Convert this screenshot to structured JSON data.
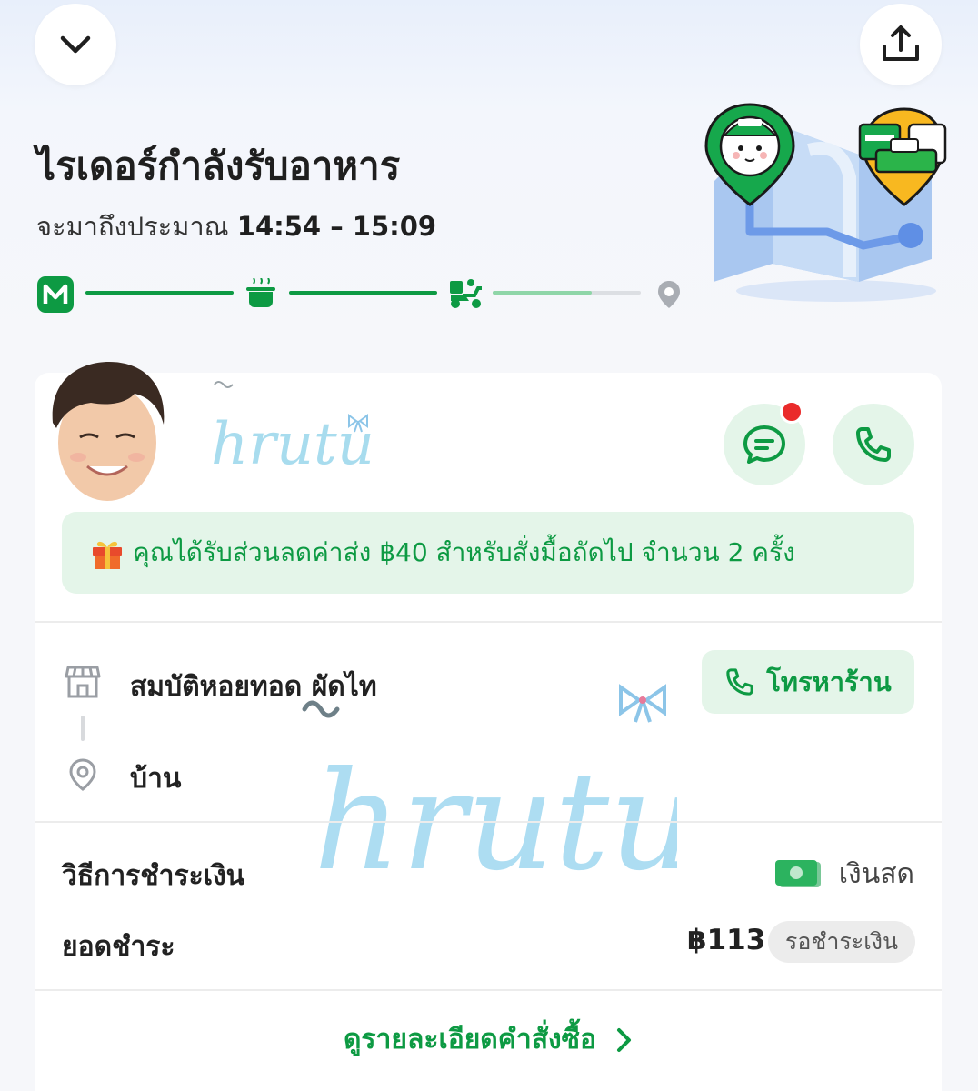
{
  "header": {
    "back_icon": "chevron-down-icon",
    "share_icon": "share-icon"
  },
  "status": {
    "title": "ไรเดอร์กำลังรับอาหาร",
    "eta_prefix": "จะมาถึงประมาณ ",
    "eta_time": "14:54 – 15:09",
    "steps": [
      "line-man-logo-icon",
      "cooking-pot-icon",
      "delivery-scooter-icon",
      "location-pin-icon"
    ],
    "progress_last_leg": 0.67
  },
  "rider": {
    "chat_icon": "chat-bubble-icon",
    "call_icon": "phone-icon",
    "has_unread": true
  },
  "watermark": {
    "text": "hrutu"
  },
  "promo": {
    "icon": "gift-icon",
    "text": "คุณได้รับส่วนลดค่าส่ง ฿40 สำหรับสั่งมื้อถัดไป จำนวน 2 ครั้ง"
  },
  "route": {
    "store_name": "สมบัติหอยทอด ผัดไท",
    "destination": "บ้าน",
    "call_store_label": "โทรหาร้าน"
  },
  "payment": {
    "method_label": "วิธีการชำระเงิน",
    "method_value": "เงินสด",
    "total_label": "ยอดชำระ",
    "total_value": "฿113",
    "status": "รอชำระเงิน"
  },
  "footer": {
    "detail_link": "ดูรายละเอียดคำสั่งซื้อ"
  },
  "colors": {
    "brand_green": "#0d9a43",
    "light_green": "#e4f5e9",
    "badge_red": "#ea2b2b"
  }
}
